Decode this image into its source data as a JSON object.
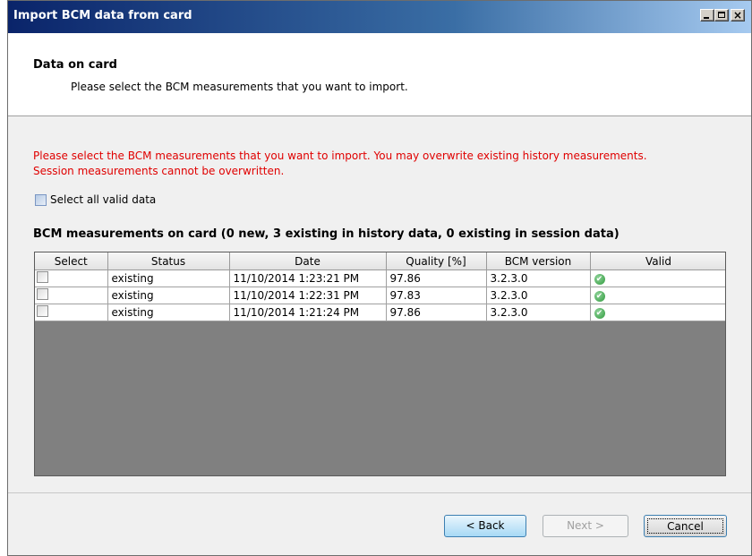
{
  "window": {
    "title": "Import BCM data from card"
  },
  "header": {
    "title": "Data on card",
    "subtitle": "Please select the BCM measurements that you want to import."
  },
  "warning": {
    "line1": "Please select the BCM measurements that you want to import. You may overwrite existing history measurements.",
    "line2": "Session measurements cannot be overwritten."
  },
  "select_all": {
    "label": "Select all valid data",
    "checked": false
  },
  "grid": {
    "title": "BCM measurements on card (0 new, 3 existing in history data, 0 existing in session data)",
    "columns": [
      "Select",
      "Status",
      "Date",
      "Quality [%]",
      "BCM version",
      "Valid"
    ],
    "rows": [
      {
        "selected": false,
        "status": "existing",
        "date": "11/10/2014 1:23:21 PM",
        "quality": "97.86",
        "version": "3.2.3.0",
        "valid": "check-icon"
      },
      {
        "selected": false,
        "status": "existing",
        "date": "11/10/2014 1:22:31 PM",
        "quality": "97.83",
        "version": "3.2.3.0",
        "valid": "check-icon"
      },
      {
        "selected": false,
        "status": "existing",
        "date": "11/10/2014 1:21:24 PM",
        "quality": "97.86",
        "version": "3.2.3.0",
        "valid": "check-icon"
      }
    ]
  },
  "buttons": {
    "back": "< Back",
    "next": "Next >",
    "cancel": "Cancel"
  },
  "colors": {
    "warning": "#e00000",
    "grid_background": "#808080",
    "valid_icon": "#2f9a3c"
  }
}
